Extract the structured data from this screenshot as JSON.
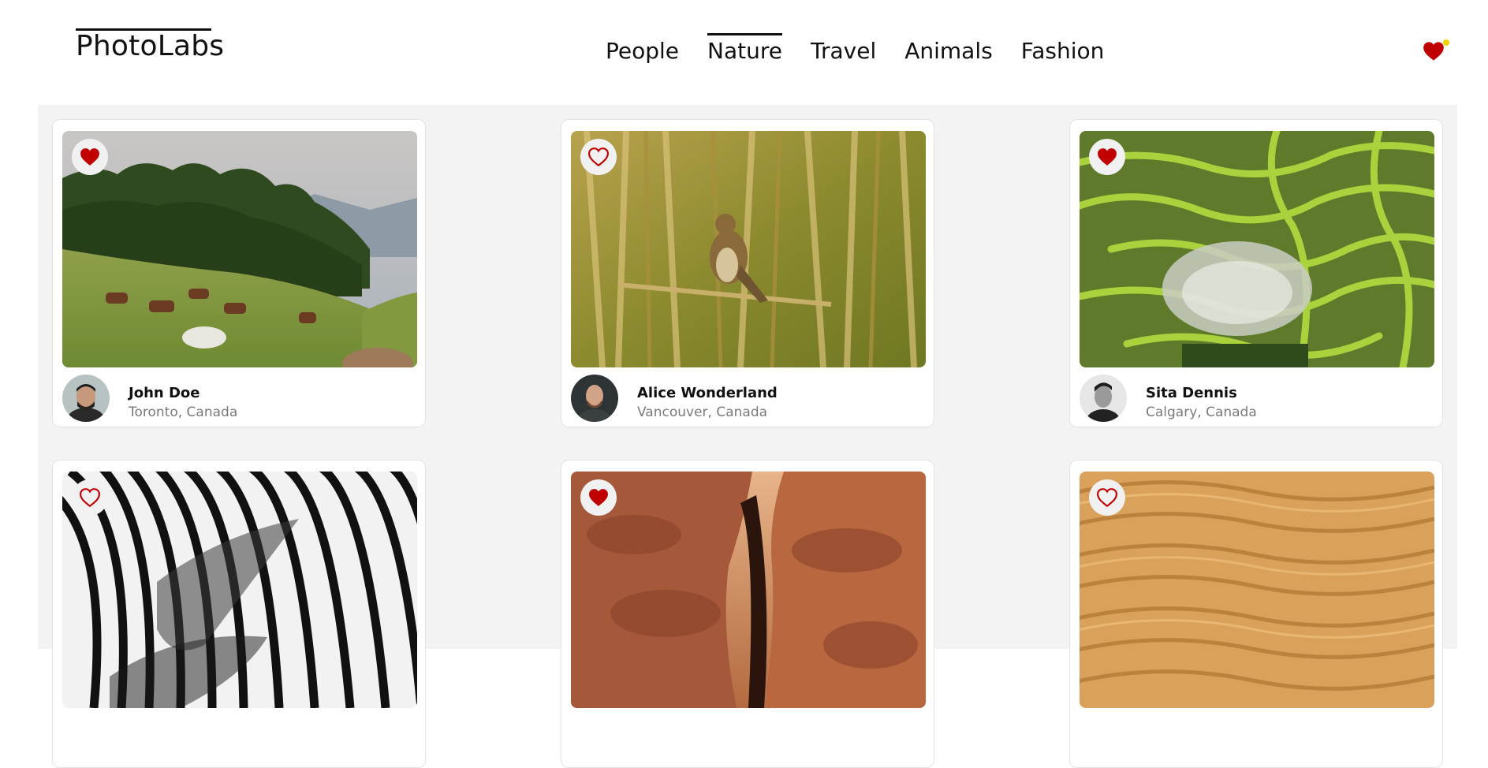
{
  "header": {
    "logo": "PhotoLabs",
    "nav": [
      "People",
      "Nature",
      "Travel",
      "Animals",
      "Fashion"
    ],
    "active_nav": "Nature",
    "favourites_has_items": true
  },
  "colors": {
    "heart": "#c00000",
    "notification_dot": "#f4d000",
    "gallery_background": "#f3f3f3"
  },
  "photos": [
    {
      "scene": "horses grazing on a hillside",
      "liked": true,
      "user": {
        "name": "John Doe",
        "location": "Toronto, Canada"
      }
    },
    {
      "scene": "bird perched among reeds",
      "liked": false,
      "user": {
        "name": "Alice Wonderland",
        "location": "Vancouver, Canada"
      }
    },
    {
      "scene": "green rice terraces",
      "liked": true,
      "user": {
        "name": "Sita Dennis",
        "location": "Calgary, Canada"
      }
    },
    {
      "scene": "zebra stripes close-up",
      "liked": false
    },
    {
      "scene": "red sandstone canyon",
      "liked": true
    },
    {
      "scene": "desert sand ripples",
      "liked": false
    }
  ]
}
